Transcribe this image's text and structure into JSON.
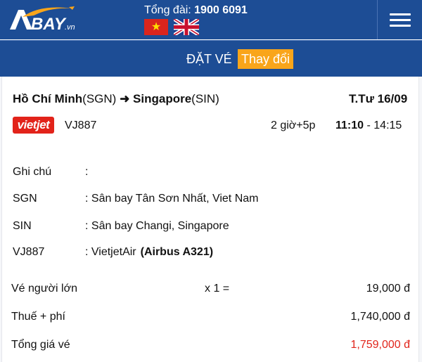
{
  "header": {
    "logo_text": "BAY",
    "logo_suffix": ".vn",
    "hotline_label": "Tổng đài: ",
    "hotline_number": "1900 6091",
    "flag_vn_icon": "vietnam-flag-icon",
    "flag_uk_icon": "uk-flag-icon",
    "menu_icon": "hamburger-menu-icon"
  },
  "subbar": {
    "title": "ĐẶT VÉ",
    "change_label": "Thay đổi"
  },
  "flight": {
    "origin_city": "Hồ Chí Minh",
    "origin_code": "(SGN)",
    "arrow": "➜",
    "dest_city": "Singapore",
    "dest_code": "(SIN)",
    "date": "T.Tư 16/09",
    "airline_logo": "vietjet",
    "flight_no": "VJ887",
    "duration": "2 giờ+5p",
    "depart": "11:10",
    "arrive_sep": " - ",
    "arrive": "14:15"
  },
  "details": {
    "note_label": "Ghi chú",
    "note_value": ":",
    "sgn_label": "SGN",
    "sgn_value": ": Sân bay Tân Sơn Nhất, Viet Nam",
    "sin_label": "SIN",
    "sin_value": ": Sân bay Changi, Singapore",
    "vj_label": "VJ887",
    "vj_value": ":  VietjetAir",
    "vj_aircraft": "(Airbus A321)"
  },
  "fare": {
    "adult_label": "Vé người lớn",
    "adult_qty": "x 1 =",
    "adult_amount": "19,000 đ",
    "tax_label": "Thuế + phí",
    "tax_amount": "1,740,000 đ",
    "total_label": "Tổng giá vé",
    "total_amount": "1,759,000 đ",
    "total_color": "#e1251b"
  },
  "colors": {
    "header_bg": "#1d4d95",
    "accent": "#f9a51a"
  }
}
